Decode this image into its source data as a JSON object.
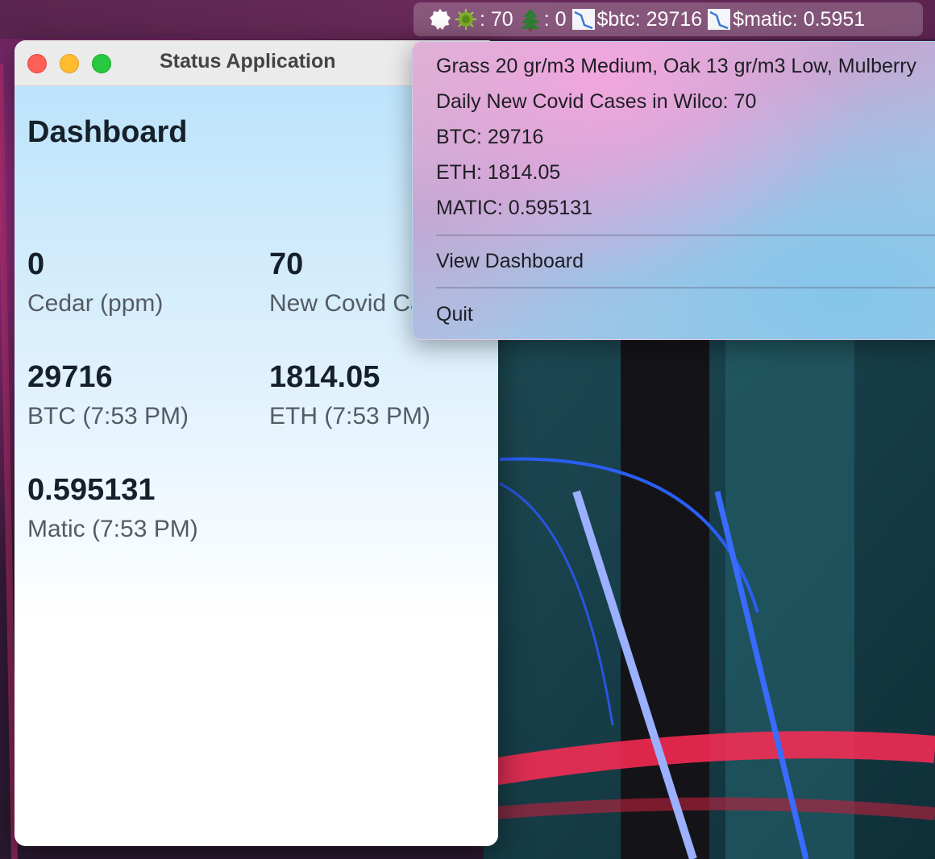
{
  "menubar": {
    "status_text": {
      "covid_value": ": 70",
      "tree_value": ": 0",
      "btc": "$btc: 29716",
      "matic": "$matic: 0.5951"
    },
    "icons": [
      "app-gear-icon",
      "virus-icon",
      "tree-icon",
      "chart-down-icon",
      "chart-down-icon"
    ]
  },
  "window": {
    "title": "Status Application",
    "dashboard": {
      "heading": "Dashboard",
      "stats": [
        {
          "value": "0",
          "label": "Cedar (ppm)"
        },
        {
          "value": "70",
          "label": "New Covid Cases"
        },
        {
          "value": "29716",
          "label": "BTC (7:53 PM)"
        },
        {
          "value": "1814.05",
          "label": "ETH (7:53 PM)"
        },
        {
          "value": "0.595131",
          "label": "Matic (7:53 PM)"
        }
      ]
    }
  },
  "dropdown": {
    "items": [
      "Grass 20 gr/m3 Medium, Oak 13 gr/m3 Low, Mulberry",
      "Daily New Covid Cases in Wilco: 70",
      "BTC: 29716",
      "ETH: 1814.05",
      "MATIC: 0.595131"
    ],
    "view_dashboard": "View Dashboard",
    "quit": "Quit"
  },
  "colors": {
    "menubar": "#5a2550",
    "window_gradient_top": "#bde3fb",
    "text_dark": "#15202b",
    "text_label": "#555b63"
  }
}
